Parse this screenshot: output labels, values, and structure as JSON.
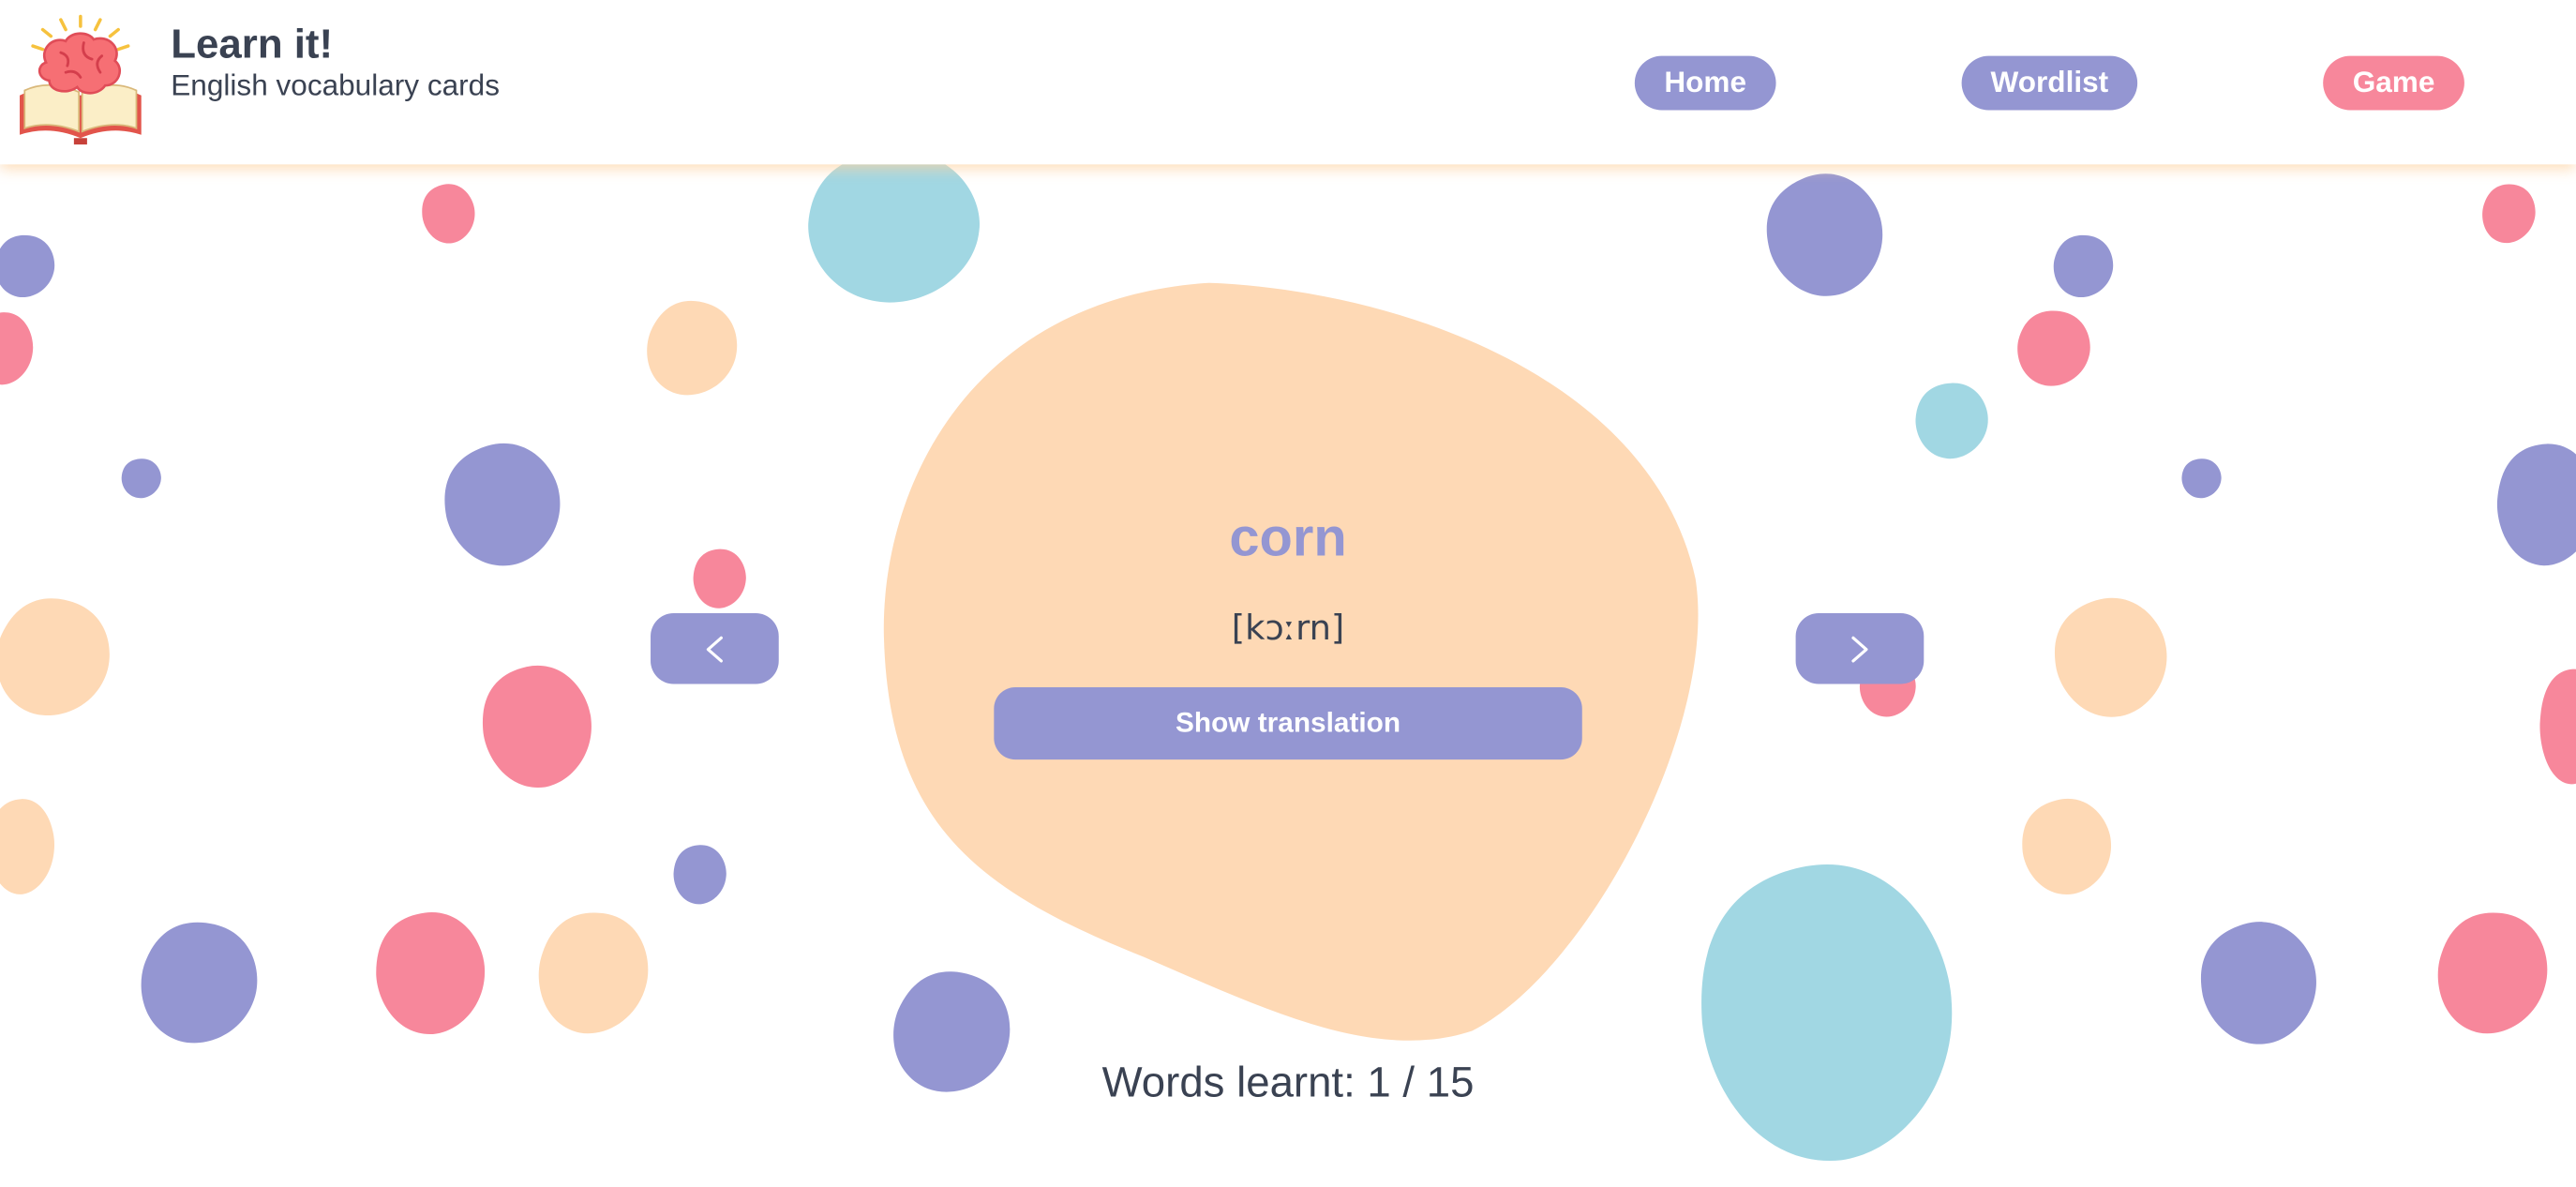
{
  "app": {
    "title": "Learn it!",
    "subtitle": "English vocabulary cards"
  },
  "nav": {
    "home_label": "Home",
    "wordlist_label": "Wordlist",
    "game_label": "Game"
  },
  "card": {
    "word": "corn",
    "transcription": "[kɔːrn]",
    "show_translation_label": "Show translation"
  },
  "progress": {
    "label": "Words learnt: 1 / 15",
    "learnt": 1,
    "total": 15
  },
  "icons": {
    "logo": "brain-on-book-logo",
    "prev": "chevron-left-icon",
    "next": "chevron-right-icon"
  },
  "colors": {
    "purple": "#9496d2",
    "pink": "#f7879b",
    "peach": "#fed9b5",
    "blue": "#a1d7e3",
    "text": "#3a4252"
  }
}
